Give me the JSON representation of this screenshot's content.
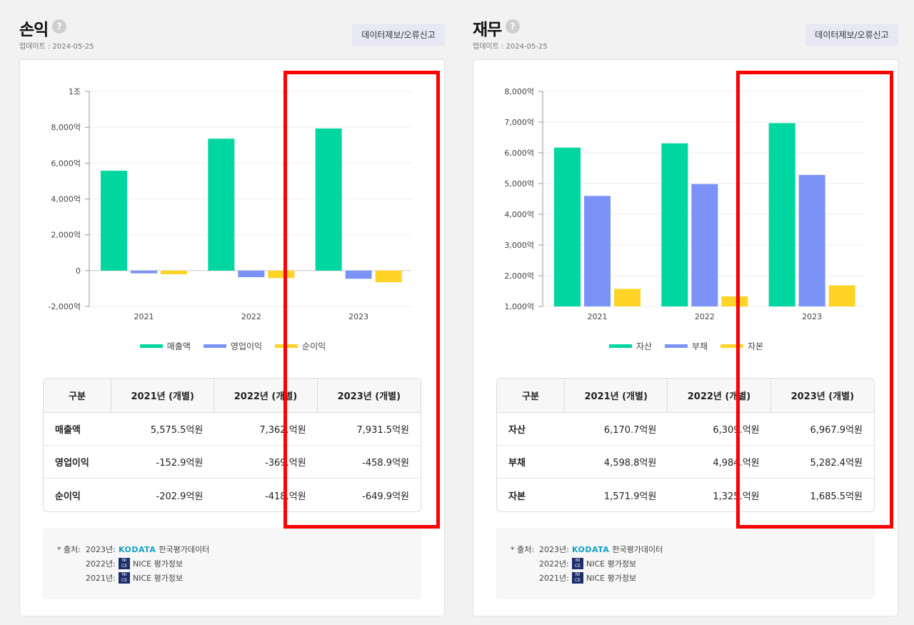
{
  "left": {
    "title": "손익",
    "help": "?",
    "updated": "업데이트 : 2024-05-25",
    "report_label": "데이터제보/오류신고",
    "chart_data": {
      "type": "bar",
      "categories": [
        "2021",
        "2022",
        "2023"
      ],
      "series": [
        {
          "name": "매출액",
          "color": "#00d69f",
          "values": [
            5575.5,
            7362,
            7931.5
          ]
        },
        {
          "name": "영업이익",
          "color": "#7b93f7",
          "values": [
            -152.9,
            -369,
            -458.9
          ]
        },
        {
          "name": "순이익",
          "color": "#ffd426",
          "values": [
            -202.9,
            -418,
            -649.9
          ]
        }
      ],
      "ylim": [
        -2000,
        10000
      ],
      "yticks": [
        -2000,
        0,
        2000,
        4000,
        6000,
        8000,
        10000
      ],
      "ytick_labels": [
        "-2,000억",
        "0",
        "2,000억",
        "4,000억",
        "6,000억",
        "8,000억",
        "1조"
      ],
      "grid": true,
      "legend": "bottom"
    },
    "table": {
      "headers": [
        "구분",
        "2021년 (개별)",
        "2022년 (개별)",
        "2023년 (개별)"
      ],
      "rows": [
        {
          "label": "매출액",
          "values": [
            "5,575.5억원",
            "7,362.억원",
            "7,931.5억원"
          ]
        },
        {
          "label": "영업이익",
          "values": [
            "-152.9억원",
            "-369.억원",
            "-458.9억원"
          ]
        },
        {
          "label": "순이익",
          "values": [
            "-202.9억원",
            "-418.억원",
            "-649.9억원"
          ]
        }
      ]
    },
    "source": {
      "label": "* 출처:",
      "rows": [
        {
          "year": "2023년:",
          "logo": "KODATA",
          "name": "한국평가데이터"
        },
        {
          "year": "2022년:",
          "logo": "NICE",
          "name": "NICE 평가정보"
        },
        {
          "year": "2021년:",
          "logo": "NICE",
          "name": "NICE 평가정보"
        }
      ]
    }
  },
  "right": {
    "title": "재무",
    "help": "?",
    "updated": "업데이트 : 2024-05-25",
    "report_label": "데이터제보/오류신고",
    "chart_data": {
      "type": "bar",
      "categories": [
        "2021",
        "2022",
        "2023"
      ],
      "series": [
        {
          "name": "자산",
          "color": "#00d69f",
          "values": [
            6170.7,
            6309,
            6967.9
          ]
        },
        {
          "name": "부채",
          "color": "#7b93f7",
          "values": [
            4598.8,
            4984,
            5282.4
          ]
        },
        {
          "name": "자본",
          "color": "#ffd426",
          "values": [
            1571.9,
            1325,
            1685.5
          ]
        }
      ],
      "ylim": [
        1000,
        8000
      ],
      "yticks": [
        1000,
        2000,
        3000,
        4000,
        5000,
        6000,
        7000,
        8000
      ],
      "ytick_labels": [
        "1,000억",
        "2,000억",
        "3,000억",
        "4,000억",
        "5,000억",
        "6,000억",
        "7,000억",
        "8,000억"
      ],
      "grid": true,
      "legend": "bottom"
    },
    "table": {
      "headers": [
        "구분",
        "2021년 (개별)",
        "2022년 (개별)",
        "2023년 (개별)"
      ],
      "rows": [
        {
          "label": "자산",
          "values": [
            "6,170.7억원",
            "6,309.억원",
            "6,967.9억원"
          ]
        },
        {
          "label": "부채",
          "values": [
            "4,598.8억원",
            "4,984.억원",
            "5,282.4억원"
          ]
        },
        {
          "label": "자본",
          "values": [
            "1,571.9억원",
            "1,325.억원",
            "1,685.5억원"
          ]
        }
      ]
    },
    "source": {
      "label": "* 출처:",
      "rows": [
        {
          "year": "2023년:",
          "logo": "KODATA",
          "name": "한국평가데이터"
        },
        {
          "year": "2022년:",
          "logo": "NICE",
          "name": "NICE 평가정보"
        },
        {
          "year": "2021년:",
          "logo": "NICE",
          "name": "NICE 평가정보"
        }
      ]
    }
  }
}
